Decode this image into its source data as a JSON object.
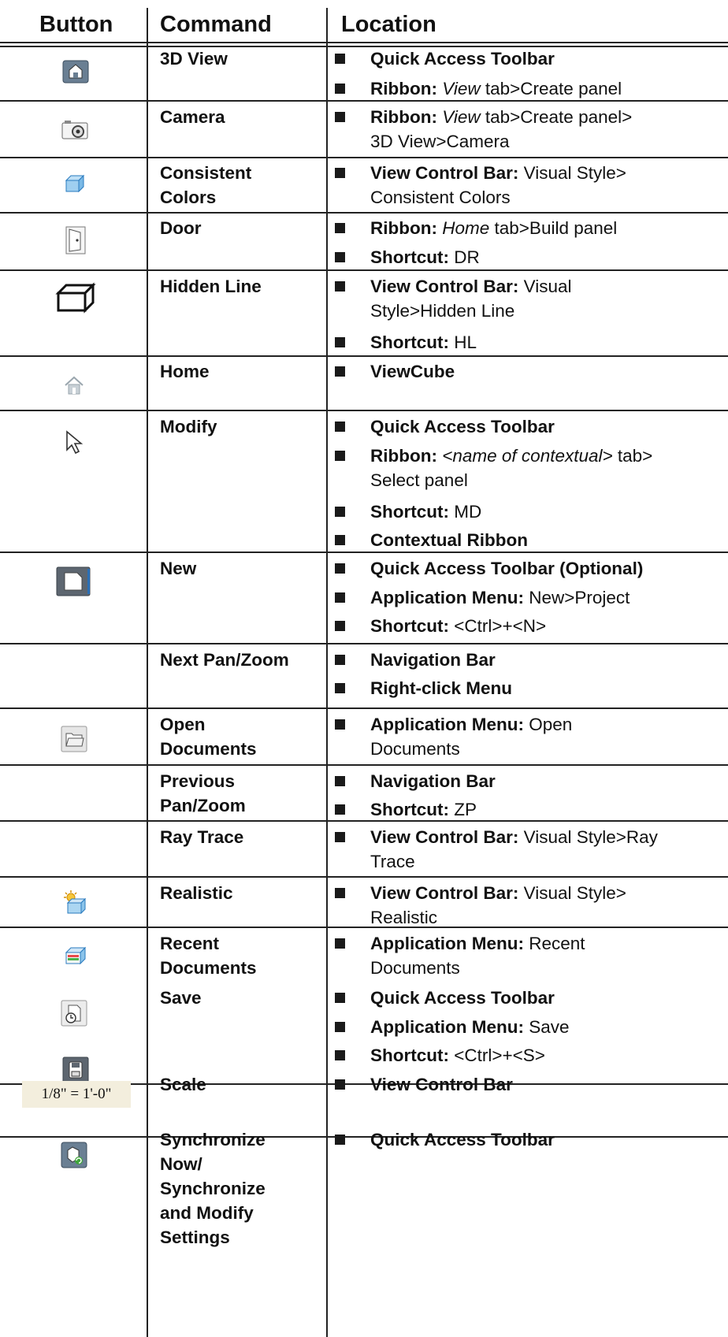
{
  "headers": {
    "button": "Button",
    "command": "Command",
    "location": "Location"
  },
  "rows": [
    {
      "command": "3D View",
      "icon": "3d-view-house-icon",
      "items": [
        {
          "label": "Quick Access Toolbar",
          "rest": ""
        },
        {
          "label": "Ribbon:",
          "italic": "View",
          "rest": " tab>Create panel"
        }
      ]
    },
    {
      "command": "Camera",
      "icon": "camera-icon",
      "items": [
        {
          "label": "Ribbon:",
          "italic": "View",
          "rest": " tab>Create panel>",
          "rest2": "3D View>Camera"
        }
      ]
    },
    {
      "command": "Consistent",
      "command2": "Colors",
      "icon": "consistent-colors-cube-icon",
      "items": [
        {
          "label": "View Control Bar:",
          "rest": " Visual Style>",
          "rest2": "Consistent Colors"
        }
      ]
    },
    {
      "command": "Door",
      "icon": "door-icon",
      "items": [
        {
          "label": "Ribbon:",
          "italic": "Home",
          "rest": " tab>Build panel"
        },
        {
          "label": "Shortcut:",
          "rest": " DR"
        }
      ]
    },
    {
      "command": "Hidden Line",
      "icon": "hidden-line-cube-icon",
      "items": [
        {
          "label": "View Control Bar:",
          "rest": " Visual",
          "rest2": "Style>Hidden Line"
        },
        {
          "label": "Shortcut:",
          "rest": " HL"
        }
      ]
    },
    {
      "command": "Home",
      "icon": "home-icon",
      "items": [
        {
          "label": "ViewCube",
          "rest": ""
        }
      ]
    },
    {
      "command": "Modify",
      "icon": "arrow-cursor-icon",
      "items": [
        {
          "label": "Quick Access Toolbar",
          "rest": ""
        },
        {
          "label": "Ribbon:",
          "rest": " ",
          "italic": "<name of contextual>",
          "rest_after": " tab>",
          "rest2": "Select panel"
        },
        {
          "label": "Shortcut:",
          "rest": " MD"
        },
        {
          "label": "Contextual Ribbon",
          "rest": ""
        }
      ]
    },
    {
      "command": "New",
      "icon": "new-document-icon",
      "items": [
        {
          "label": "Quick Access Toolbar (Optional)",
          "rest": ""
        },
        {
          "label": "Application Menu:",
          "rest": " New>Project"
        },
        {
          "label": "Shortcut:",
          "rest": " <Ctrl>+<N>"
        }
      ]
    },
    {
      "command": "Next Pan/Zoom",
      "icon": "",
      "items": [
        {
          "label": "Navigation Bar",
          "rest": ""
        },
        {
          "label": "Right-click Menu",
          "rest": ""
        }
      ]
    },
    {
      "command": "Open",
      "command2": "Documents",
      "icon": "open-folder-icon",
      "items": [
        {
          "label": "Application Menu:",
          "rest": " Open",
          "rest2": "Documents"
        }
      ]
    },
    {
      "command": "Previous",
      "command2": "Pan/Zoom",
      "icon": "",
      "items": [
        {
          "label": "Navigation Bar",
          "rest": ""
        },
        {
          "label": "Shortcut:",
          "rest": " ZP"
        }
      ]
    },
    {
      "command": "Ray Trace",
      "icon": "ray-trace-sun-cube-icon",
      "items": [
        {
          "label": "View Control Bar:",
          "rest": " Visual Style>Ray",
          "rest2": "Trace"
        }
      ]
    },
    {
      "command": "Realistic",
      "icon": "realistic-cube-icon",
      "items": [
        {
          "label": "View Control Bar:",
          "rest": " Visual Style>",
          "rest2": "Realistic"
        }
      ]
    },
    {
      "command": "Recent",
      "command2": "Documents",
      "icon": "recent-documents-icon",
      "items": [
        {
          "label": "Application Menu:",
          "rest": " Recent",
          "rest2": "Documents"
        }
      ]
    },
    {
      "command": "Save",
      "icon": "save-floppy-icon",
      "items": [
        {
          "label": "Quick Access Toolbar",
          "rest": ""
        },
        {
          "label": "Application Menu:",
          "rest": " Save"
        },
        {
          "label": "Shortcut:",
          "rest": " <Ctrl>+<S>"
        }
      ]
    },
    {
      "command": "Scale",
      "icon": "scale-field-icon",
      "icon_text": "1/8\" = 1'-0\"",
      "items": [
        {
          "label": "View Control Bar",
          "rest": ""
        }
      ]
    },
    {
      "command": "Synchronize",
      "command2": "Now/",
      "command3": "Synchronize",
      "command4": "and Modify",
      "command5": "Settings",
      "icon": "synchronize-icon",
      "items": [
        {
          "label": "Quick Access Toolbar",
          "rest": ""
        }
      ]
    }
  ]
}
